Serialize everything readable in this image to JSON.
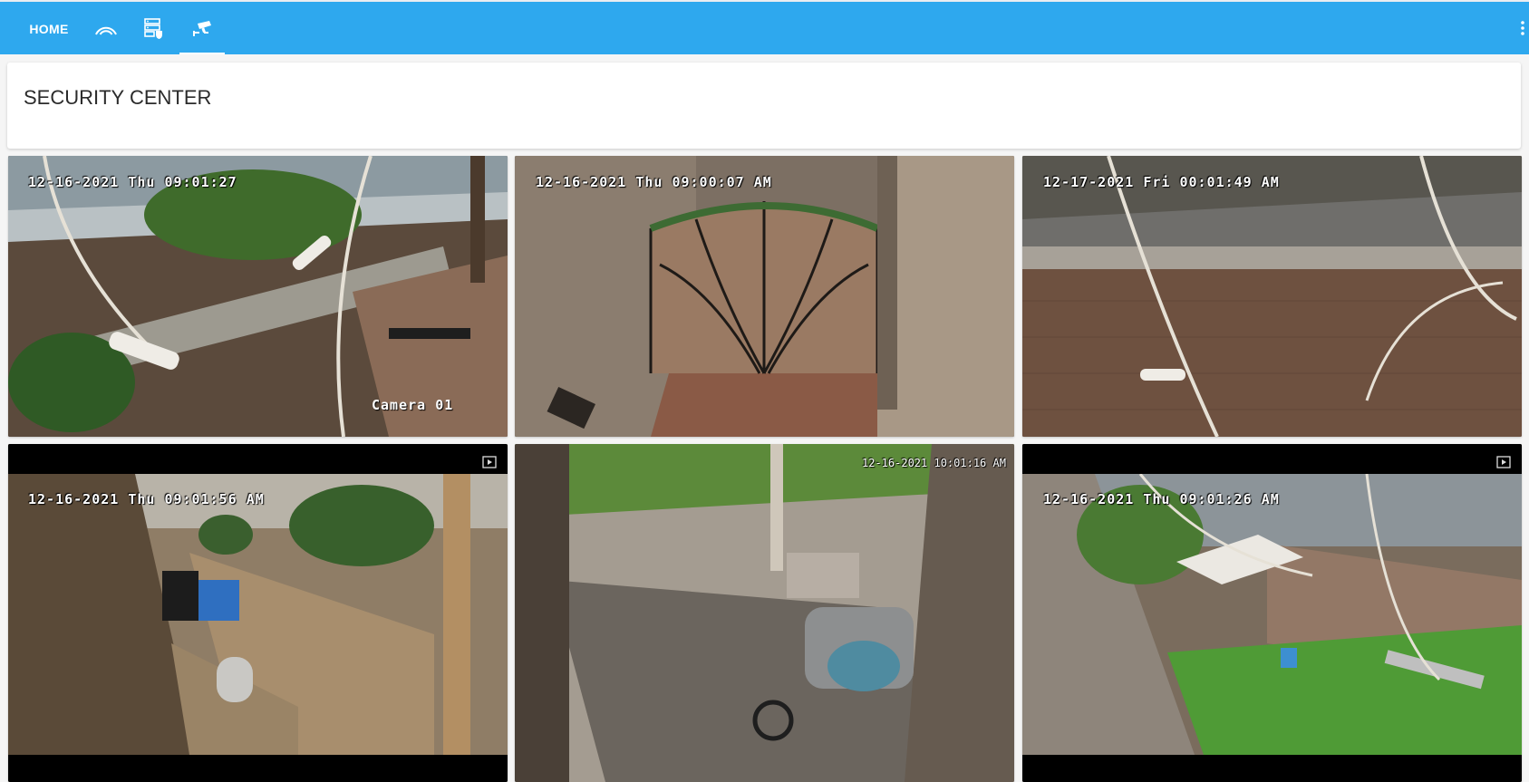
{
  "nav": {
    "home_label": "HOME",
    "tabs": [
      {
        "icon": "signal-arc-icon"
      },
      {
        "icon": "server-shield-icon"
      },
      {
        "icon": "cctv-camera-icon"
      }
    ],
    "active_tab": "cctv-camera-icon",
    "accent_color": "#2ea8ee"
  },
  "header": {
    "title": "SECURITY CENTER"
  },
  "cameras": [
    {
      "timestamp": "12-16-2021 Thu 09:01:27",
      "label": "Camera 01"
    },
    {
      "timestamp": "12-16-2021 Thu 09:00:07 AM"
    },
    {
      "timestamp": "12-17-2021 Fri 00:01:49 AM"
    },
    {
      "timestamp": "12-16-2021 Thu 09:01:56 AM"
    },
    {
      "timestamp": "12-16-2021 10:01:16 AM"
    },
    {
      "timestamp": "12-16-2021 Thu 09:01:26 AM"
    }
  ]
}
